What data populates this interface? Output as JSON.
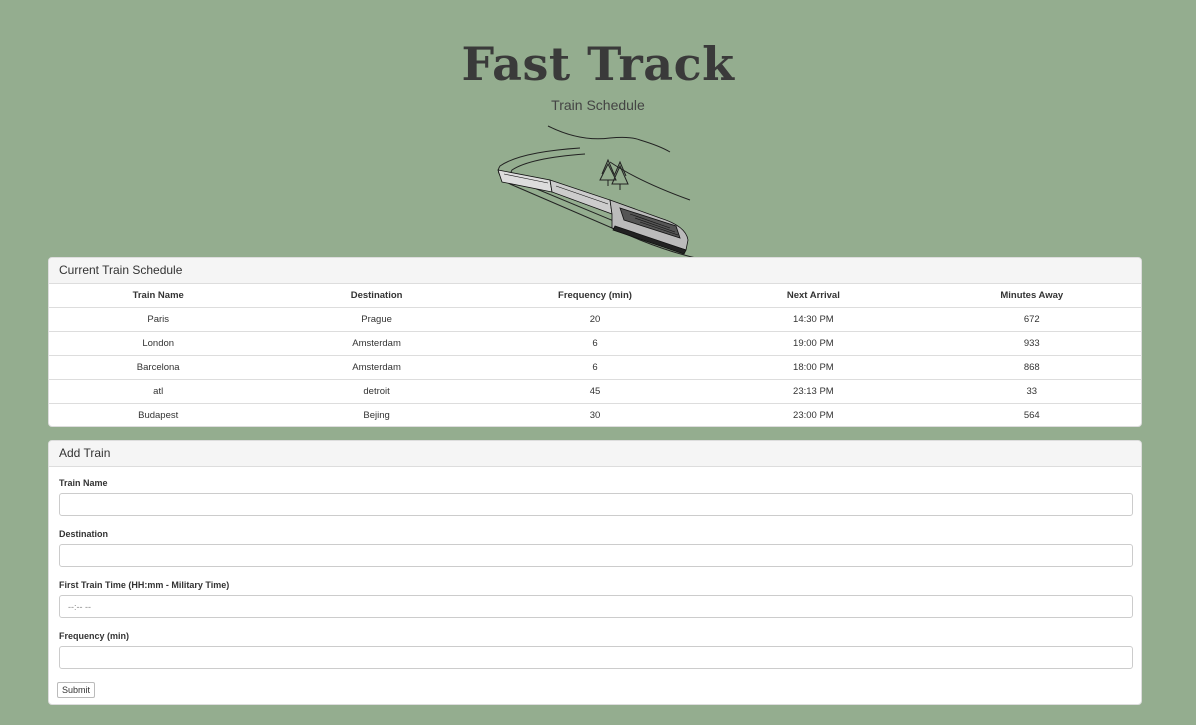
{
  "header": {
    "title": "Fast Track",
    "subtitle": "Train Schedule"
  },
  "schedule": {
    "heading": "Current Train Schedule",
    "columns": [
      "Train Name",
      "Destination",
      "Frequency (min)",
      "Next Arrival",
      "Minutes Away"
    ],
    "rows": [
      [
        "Paris",
        "Prague",
        "20",
        "14:30 PM",
        "672"
      ],
      [
        "London",
        "Amsterdam",
        "6",
        "19:00 PM",
        "933"
      ],
      [
        "Barcelona",
        "Amsterdam",
        "6",
        "18:00 PM",
        "868"
      ],
      [
        "atl",
        "detroit",
        "45",
        "23:13 PM",
        "33"
      ],
      [
        "Budapest",
        "Bejing",
        "30",
        "23:00 PM",
        "564"
      ]
    ]
  },
  "add_train": {
    "heading": "Add Train",
    "fields": [
      {
        "label": "Train Name",
        "value": "",
        "placeholder": ""
      },
      {
        "label": "Destination",
        "value": "",
        "placeholder": ""
      },
      {
        "label": "First Train Time (HH:mm - Military Time)",
        "value": "",
        "placeholder": "--:-- --"
      },
      {
        "label": "Frequency (min)",
        "value": "",
        "placeholder": ""
      }
    ],
    "submit_label": "Submit"
  },
  "colors": {
    "background": "#94ad8f",
    "panel_heading": "#f5f5f5",
    "title_text": "#3a3a3a"
  },
  "icons": {
    "train_illustration": "train-illustration-icon"
  }
}
